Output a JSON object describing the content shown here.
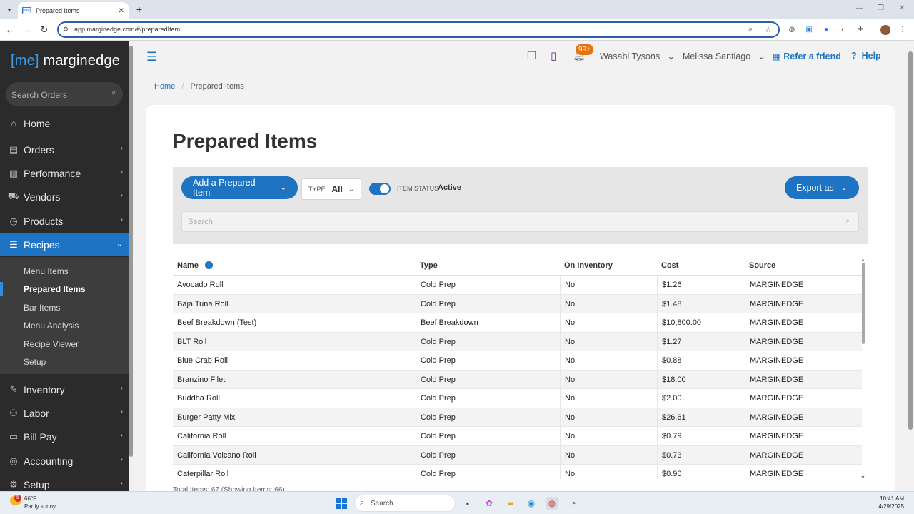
{
  "browser": {
    "tab_title": "Prepared Items",
    "tab_favicon": "[me]",
    "url": "app.marginedge.com/#/preparedItem"
  },
  "sidebar": {
    "logo_bracket": "[me]",
    "logo_text": " marginedge",
    "search_placeholder": "Search Orders",
    "items": [
      {
        "label": "Home",
        "icon": "house-icon",
        "chevron": false
      },
      {
        "label": "Orders",
        "icon": "orders-icon",
        "chevron": true
      },
      {
        "label": "Performance",
        "icon": "chart-icon",
        "chevron": true
      },
      {
        "label": "Vendors",
        "icon": "truck-icon",
        "chevron": true
      },
      {
        "label": "Products",
        "icon": "product-icon",
        "chevron": true
      },
      {
        "label": "Recipes",
        "icon": "recipe-icon",
        "chevron": true,
        "active": true
      }
    ],
    "sub_items": [
      {
        "label": "Menu Items"
      },
      {
        "label": "Prepared Items",
        "active": true
      },
      {
        "label": "Bar Items"
      },
      {
        "label": "Menu Analysis"
      },
      {
        "label": "Recipe Viewer"
      },
      {
        "label": "Setup"
      }
    ],
    "lower_items": [
      {
        "label": "Inventory",
        "icon": "inventory-icon"
      },
      {
        "label": "Labor",
        "icon": "labor-icon"
      },
      {
        "label": "Bill Pay",
        "icon": "billpay-icon"
      },
      {
        "label": "Accounting",
        "icon": "accounting-icon"
      },
      {
        "label": "Setup",
        "icon": "gear-icon"
      }
    ]
  },
  "header": {
    "notification_count": "99+",
    "restaurant": "Wasabi Tysons",
    "user": "Melissa Santiago",
    "refer_label": "Refer a friend",
    "help_label": "Help"
  },
  "breadcrumb": {
    "home": "Home",
    "current": "Prepared Items"
  },
  "page": {
    "title": "Prepared Items",
    "add_button": "Add a Prepared Item",
    "type_label": "TYPE",
    "type_value": "All",
    "status_label": "ITEM STATUS",
    "status_value": "Active",
    "export_button": "Export as",
    "search_placeholder": "Search"
  },
  "table": {
    "columns": [
      "Name",
      "Type",
      "On Inventory",
      "Cost",
      "Source"
    ],
    "rows": [
      [
        "Avocado Roll",
        "Cold Prep",
        "No",
        "$1.26",
        "MARGINEDGE"
      ],
      [
        "Baja Tuna Roll",
        "Cold Prep",
        "No",
        "$1.48",
        "MARGINEDGE"
      ],
      [
        "Beef Breakdown (Test)",
        "Beef Breakdown",
        "No",
        "$10,800.00",
        "MARGINEDGE"
      ],
      [
        "BLT Roll",
        "Cold Prep",
        "No",
        "$1.27",
        "MARGINEDGE"
      ],
      [
        "Blue Crab Roll",
        "Cold Prep",
        "No",
        "$0.88",
        "MARGINEDGE"
      ],
      [
        "Branzino Filet",
        "Cold Prep",
        "No",
        "$18.00",
        "MARGINEDGE"
      ],
      [
        "Buddha Roll",
        "Cold Prep",
        "No",
        "$2.00",
        "MARGINEDGE"
      ],
      [
        "Burger Patty Mix",
        "Cold Prep",
        "No",
        "$26.61",
        "MARGINEDGE"
      ],
      [
        "California Roll",
        "Cold Prep",
        "No",
        "$0.79",
        "MARGINEDGE"
      ],
      [
        "California Volcano Roll",
        "Cold Prep",
        "No",
        "$0.73",
        "MARGINEDGE"
      ],
      [
        "Caterpillar Roll",
        "Cold Prep",
        "No",
        "$0.90",
        "MARGINEDGE"
      ]
    ],
    "footer": "Total Items: 67 (Showing Items: 66)"
  },
  "taskbar": {
    "weather_badge": "5",
    "temperature": "66°F",
    "weather": "Partly sunny",
    "search_placeholder": "Search",
    "time": "10:41 AM",
    "date": "4/29/2025"
  },
  "colors": {
    "brand_blue": "#1e73c2",
    "sidebar_bg": "#2b2b2b",
    "badge_orange": "#e8720c"
  }
}
